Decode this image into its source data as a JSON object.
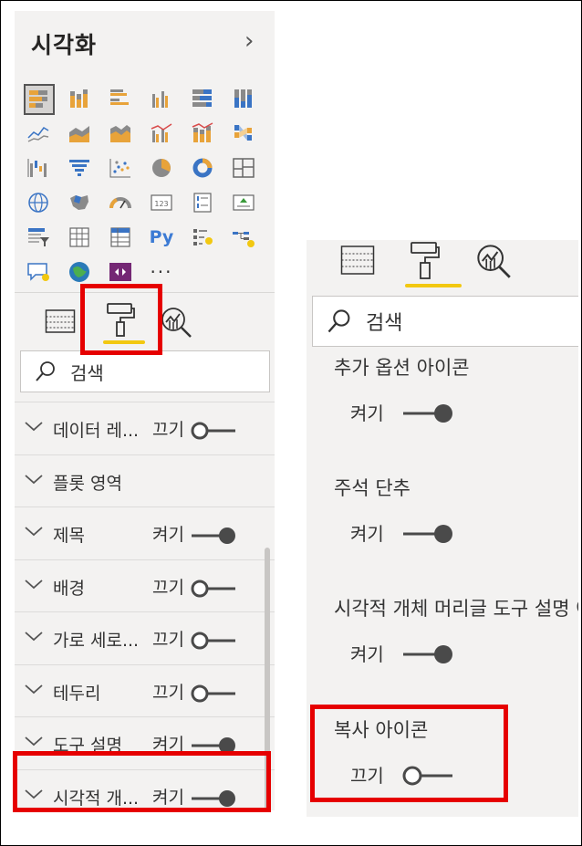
{
  "left_panel": {
    "title": "시각화",
    "search_placeholder": "검색",
    "visual_icons": [
      "stacked-bar-chart-icon",
      "stacked-column-chart-icon",
      "clustered-bar-chart-icon",
      "clustered-column-chart-icon",
      "100-stacked-bar-chart-icon",
      "100-stacked-column-chart-icon",
      "line-chart-icon",
      "area-chart-icon",
      "stacked-area-chart-icon",
      "line-clustered-column-chart-icon",
      "line-stacked-column-chart-icon",
      "ribbon-chart-icon",
      "waterfall-chart-icon",
      "funnel-chart-icon",
      "scatter-chart-icon",
      "pie-chart-icon",
      "donut-chart-icon",
      "treemap-icon",
      "map-icon",
      "filled-map-icon",
      "gauge-icon",
      "card-icon",
      "multi-row-card-icon",
      "kpi-icon",
      "slicer-icon",
      "table-icon",
      "matrix-icon",
      "python-visual-icon",
      "key-influencers-icon",
      "decomposition-tree-icon",
      "qa-icon",
      "arcgis-map-icon",
      "power-apps-icon",
      "more-visuals-icon"
    ],
    "python_label": "Py",
    "more_label": "···",
    "sections": [
      {
        "label": "데이터 레...",
        "state": "끄기",
        "on": false
      },
      {
        "label": "플롯 영역",
        "state": "",
        "on": null
      },
      {
        "label": "제목",
        "state": "켜기",
        "on": true
      },
      {
        "label": "배경",
        "state": "끄기",
        "on": false
      },
      {
        "label": "가로 세로...",
        "state": "끄기",
        "on": false
      },
      {
        "label": "테두리",
        "state": "끄기",
        "on": false
      },
      {
        "label": "도구 설명",
        "state": "켜기",
        "on": true
      },
      {
        "label": "시각적 개...",
        "state": "켜기",
        "on": true
      }
    ]
  },
  "right_panel": {
    "search_placeholder": "검색",
    "options": [
      {
        "title": "추가 옵션 아이콘",
        "state": "켜기",
        "on": true
      },
      {
        "title": "주석 단추",
        "state": "켜기",
        "on": true
      },
      {
        "title": "시각적 개체 머리글 도구 설명 아이콘",
        "state": "켜기",
        "on": true
      },
      {
        "title": "복사 아이콘",
        "state": "끄기",
        "on": false
      }
    ]
  },
  "colors": {
    "pane_bg": "#f3f2f1",
    "accent_underline": "#f2c811",
    "highlight": "#e60000",
    "toggle": "#4a4a4a"
  }
}
